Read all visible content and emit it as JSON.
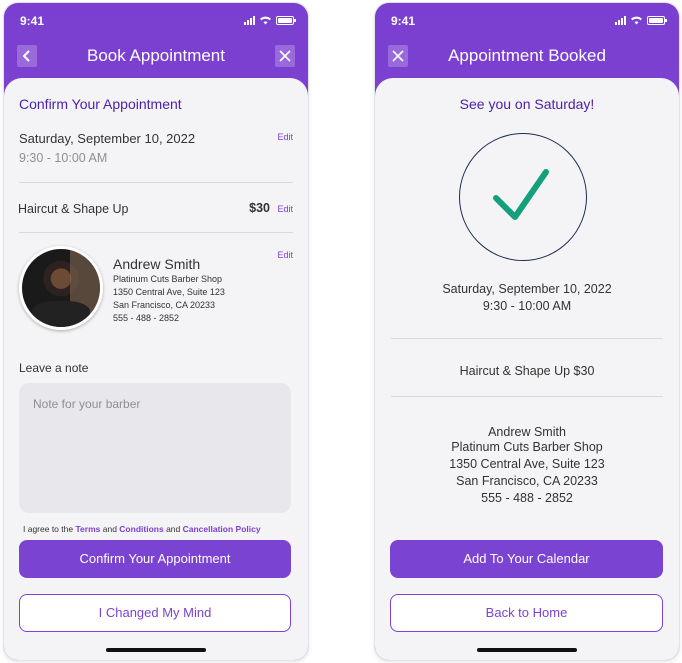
{
  "status": {
    "time": "9:41"
  },
  "left_screen": {
    "title": "Book Appointment",
    "confirm_heading": "Confirm Your Appointment",
    "date": "Saturday, September 10, 2022",
    "time_range": "9:30 - 10:00 AM",
    "edit_label": "Edit",
    "service": "Haircut & Shape Up",
    "price": "$30",
    "barber": {
      "name": "Andrew Smith",
      "shop": "Platinum Cuts Barber Shop",
      "address1": "1350 Central Ave, Suite 123",
      "address2": "San Francisco, CA 20233",
      "phone": "555 - 488 - 2852"
    },
    "note_label": "Leave a note",
    "note_placeholder": "Note for your barber",
    "agree_text_1": "I agree to the",
    "terms": "Terms",
    "and_1": "and",
    "conditions": "Conditions",
    "and_2": "and",
    "cancellation": "Cancellation Policy",
    "confirm_button": "Confirm Your Appointment",
    "changed_mind_button": "I Changed My Mind"
  },
  "right_screen": {
    "title": "Appointment Booked",
    "heading": "See you on Saturday!",
    "date": "Saturday, September 10, 2022",
    "time_range": "9:30 - 10:00 AM",
    "service_price": "Haircut & Shape Up $30",
    "barber": {
      "name": "Andrew Smith",
      "shop": "Platinum Cuts Barber Shop",
      "address1": "1350 Central Ave, Suite 123",
      "address2": "San Francisco, CA 20233",
      "phone": "555 - 488 - 2852"
    },
    "calendar_button": "Add To Your Calendar",
    "home_button": "Back to Home"
  },
  "colors": {
    "accent": "#7b43d2",
    "heading": "#4b1fa8",
    "check": "#13a07a"
  },
  "icons": [
    "back-icon",
    "close-icon",
    "checkmark-icon",
    "signal-icon",
    "wifi-icon",
    "battery-icon"
  ]
}
